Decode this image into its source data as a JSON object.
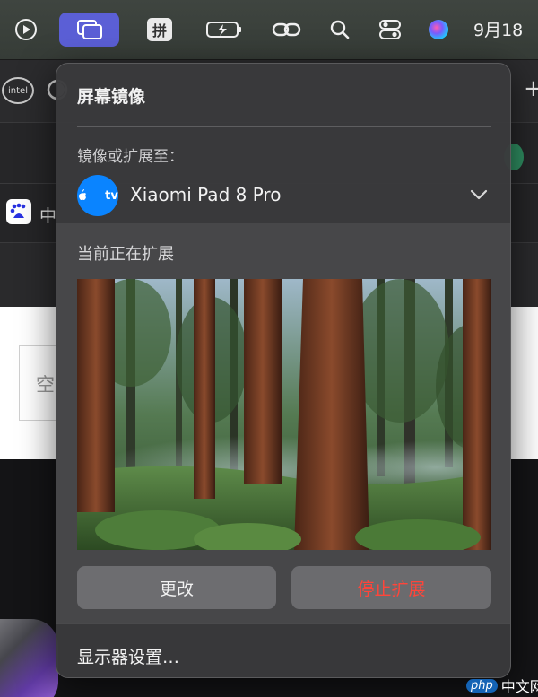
{
  "menubar": {
    "icons": [
      "play-circle-icon",
      "screen-mirroring-icon",
      "input-method-icon",
      "battery-charging-icon",
      "link-icon",
      "search-icon",
      "control-center-icon",
      "siri-icon"
    ],
    "input_method_label": "拼",
    "clock": "9月18"
  },
  "background": {
    "intel_label": "intel",
    "bookmark_text": "中",
    "page_box_text": "空"
  },
  "popover": {
    "title": "屏幕镜像",
    "mirror_label": "镜像或扩展至：",
    "device": {
      "icon_text": "tv",
      "name": "Xiaomi Pad 8 Pro"
    },
    "status_label": "当前正在扩展",
    "buttons": {
      "change": "更改",
      "stop": "停止扩展"
    },
    "settings_link": "显示器设置…",
    "colors": {
      "accent": "#0a84ff",
      "stop": "#ff453a",
      "active_menubar": "#5b5fd6"
    }
  },
  "watermark": {
    "badge": "php",
    "text": "中文网"
  }
}
